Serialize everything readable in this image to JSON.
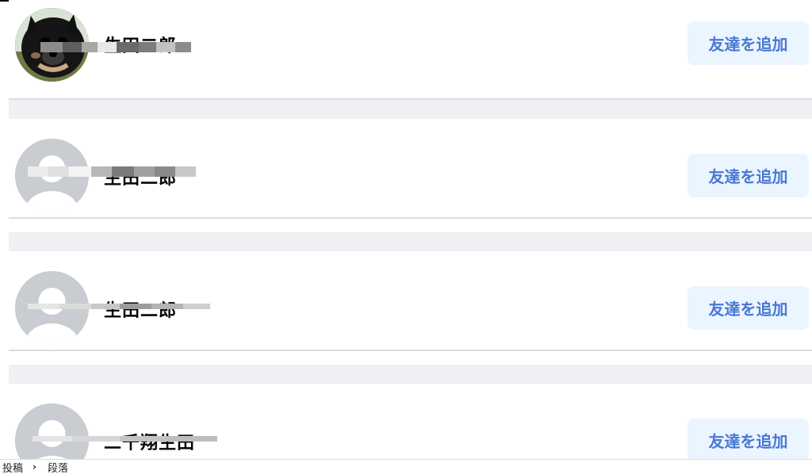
{
  "friends": [
    {
      "name": "生田二郎",
      "button_label": "友達を追加",
      "avatar": "dog-photo"
    },
    {
      "name": "生田二郎",
      "button_label": "友達を追加",
      "avatar": "default-user"
    },
    {
      "name": "生田二郎",
      "button_label": "友達を追加",
      "avatar": "default-user"
    },
    {
      "name": "二千翔生田",
      "button_label": "友達を追加",
      "avatar": "default-user"
    }
  ],
  "breadcrumb": {
    "items": [
      "投稿",
      "段落"
    ],
    "separator_icon": "chevron-right-icon"
  },
  "colors": {
    "button_bg": "#ebf5ff",
    "button_text": "#4978d4",
    "separator_bg": "#eef0f3",
    "avatar_default_bg": "#c9ccd1"
  }
}
